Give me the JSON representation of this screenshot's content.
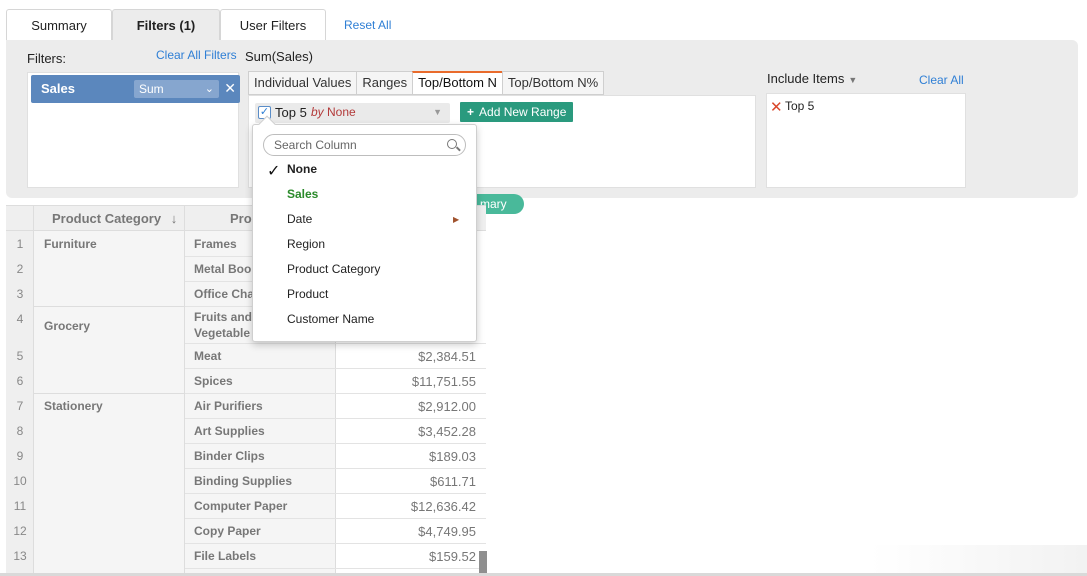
{
  "tabs": {
    "summary": "Summary",
    "filters": "Filters (1)",
    "user_filters": "User Filters",
    "reset_all": "Reset All"
  },
  "panel": {
    "filters_label": "Filters:",
    "clear_all_filters": "Clear All Filters",
    "current_filter": "Sum(Sales)",
    "filter_chip": {
      "label": "Sales",
      "aggregate": "Sum"
    },
    "sub_tabs": [
      "Individual Values",
      "Ranges",
      "Top/Bottom N",
      "Top/Bottom N%"
    ],
    "active_sub_tab": "Top/Bottom N",
    "topn": {
      "label": "Top 5",
      "by": "by",
      "by_value": "None",
      "checked": true
    },
    "add_new_range": "Add New Range",
    "include_items": "Include Items",
    "clear_all": "Clear All",
    "included": [
      "Top 5"
    ]
  },
  "summary_pill": "mary",
  "dropdown": {
    "search_placeholder": "Search Column",
    "items": [
      "None",
      "Sales",
      "Date",
      "Region",
      "Product Category",
      "Product",
      "Customer Name"
    ],
    "selected": "None"
  },
  "table": {
    "headers": {
      "category": "Product Category",
      "product": "Pro"
    },
    "row_numbers": [
      "1",
      "2",
      "3",
      "4",
      "5",
      "6",
      "7",
      "8",
      "9",
      "10",
      "11",
      "12",
      "13"
    ],
    "categories": [
      "Furniture",
      "Grocery",
      "Stationery"
    ],
    "products": [
      "Frames",
      "Metal Boo",
      "Office Cha",
      "Fruits and",
      "Vegetable",
      "Meat",
      "Spices",
      "Air Purifiers",
      "Art Supplies",
      "Binder Clips",
      "Binding Supplies",
      "Computer Paper",
      "Copy Paper",
      "File Labels"
    ],
    "values": [
      "$2,384.51",
      "$11,751.55",
      "$2,912.00",
      "$3,452.28",
      "$189.03",
      "$611.71",
      "$12,636.42",
      "$4,749.95",
      "$159.52"
    ]
  },
  "colors": {
    "accent_link": "#2f7fd5",
    "add_button": "#2a9a7e",
    "chip": "#5b87bd",
    "active_tab_top": "#e96b2c",
    "sales_item": "#2a8a2a"
  }
}
